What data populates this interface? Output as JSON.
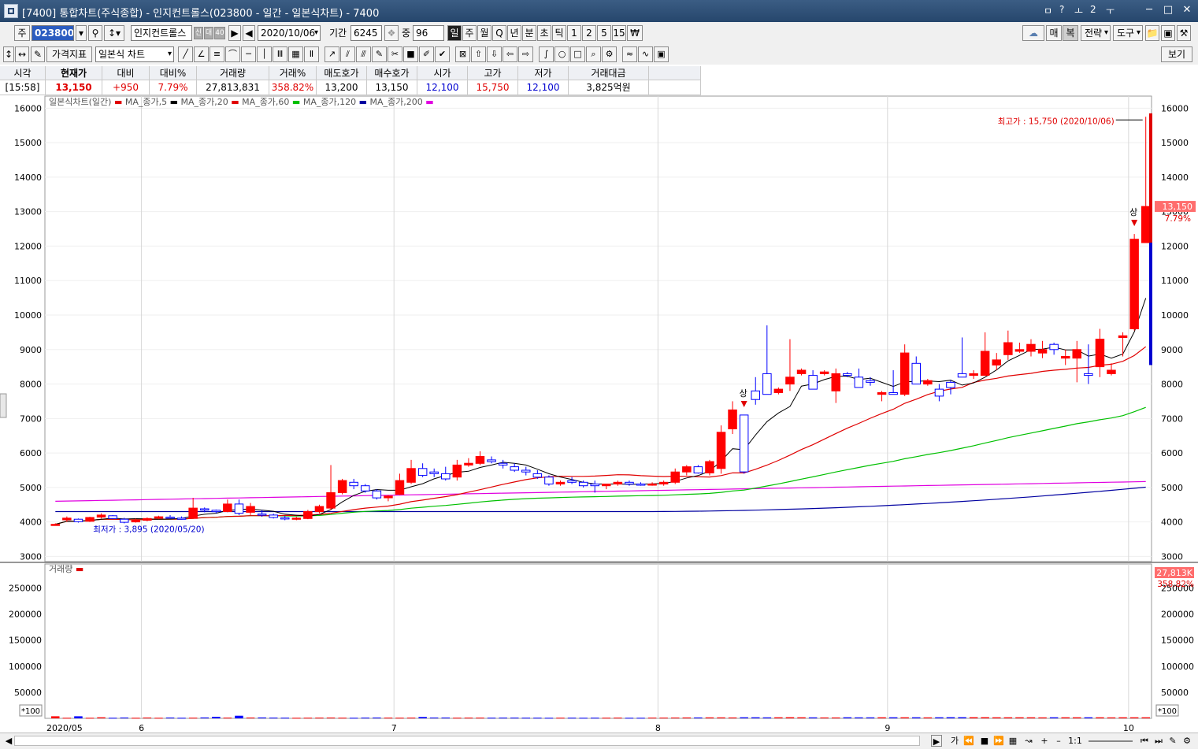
{
  "window": {
    "title": "[7400] 통합차트(주식종합) - 인지컨트롤스(023800 - 일간 - 일본식차트) - 7400",
    "title_icons": [
      "ㅁ",
      "?",
      "ㅗ",
      "2",
      "ㅜ"
    ]
  },
  "toolbar1": {
    "market_label": "주",
    "stock_code": "023800",
    "stock_name": "인지컨트롤스",
    "small_tags": [
      "신",
      "대",
      "40"
    ],
    "date": "2020/10/06",
    "period_label": "기간",
    "period_value": "6245",
    "count_label": "중",
    "count_value": "96",
    "periods": [
      "일",
      "주",
      "월",
      "Q",
      "년",
      "분",
      "초",
      "틱",
      "1",
      "2",
      "5",
      "15",
      "₩"
    ],
    "right_buttons": [
      "매",
      "복",
      "전략",
      "도구"
    ]
  },
  "toolbar2": {
    "indicator_label": "가격지표",
    "chart_type": "일본식 차트",
    "view_button": "보기"
  },
  "quote": {
    "headers": [
      "시각",
      "현재가",
      "대비",
      "대비%",
      "거래량",
      "거래%",
      "매도호가",
      "매수호가",
      "시가",
      "고가",
      "저가",
      "거래대금"
    ],
    "values": [
      "[15:58]",
      "13,150",
      "+950",
      "7.79%",
      "27,813,831",
      "358.82%",
      "13,200",
      "13,150",
      "12,100",
      "15,750",
      "12,100",
      "3,825억원"
    ]
  },
  "legend": {
    "price": "일본식차트(일간)",
    "ma5": "MA_종가,5",
    "ma20": "MA_종가,20",
    "ma60": "MA_종가,60",
    "ma120": "MA_종가,120",
    "ma200": "MA_종가,200",
    "volume": "거래량"
  },
  "colors": {
    "up": "#ff0000",
    "down": "#0000ff",
    "ma5": "#000000",
    "ma20": "#e00000",
    "ma60": "#00c000",
    "ma120": "#0000a0",
    "ma200": "#e000e0"
  },
  "bottom": {
    "first_label": "가",
    "scale_label": "1:1"
  },
  "chart_data": {
    "type": "candlestick",
    "x_tick_labels": [
      "2020/05",
      "6",
      "7",
      "8",
      "9",
      "10"
    ],
    "x_tick_index": [
      0,
      8,
      30,
      53,
      73,
      94
    ],
    "y_ticks": [
      3000,
      4000,
      5000,
      6000,
      7000,
      8000,
      9000,
      10000,
      11000,
      12000,
      13000,
      14000,
      15000,
      16000
    ],
    "ylim": [
      2850,
      16350
    ],
    "volume_ticks": [
      50000,
      100000,
      150000,
      200000,
      250000
    ],
    "volume_ylim": [
      0,
      290000
    ],
    "volume_unit": "*100",
    "current_price_label": "13,150",
    "current_change_label": "7.79%",
    "volume_current_label": "27,813K",
    "volume_change_label": "358.82%",
    "high_annotation": "최고가 : 15,750 (2020/10/06)",
    "low_annotation": "최저가 : 3,895 (2020/05/20)",
    "limit_up_marker": "상",
    "limit_up_index": [
      60,
      94
    ],
    "ohlc": [
      [
        3895,
        3960,
        3895,
        3930
      ],
      [
        4060,
        4160,
        4000,
        4110
      ],
      [
        4080,
        4100,
        3980,
        4010
      ],
      [
        4020,
        4150,
        4000,
        4130
      ],
      [
        4140,
        4250,
        4100,
        4200
      ],
      [
        4180,
        4200,
        4080,
        4100
      ],
      [
        4080,
        4120,
        3960,
        3990
      ],
      [
        4000,
        4100,
        3980,
        4060
      ],
      [
        4050,
        4130,
        4020,
        4100
      ],
      [
        4110,
        4180,
        4080,
        4150
      ],
      [
        4140,
        4200,
        4100,
        4120
      ],
      [
        4110,
        4160,
        4070,
        4090
      ],
      [
        4100,
        4700,
        4090,
        4400
      ],
      [
        4380,
        4420,
        4280,
        4350
      ],
      [
        4340,
        4360,
        4250,
        4300
      ],
      [
        4300,
        4650,
        4280,
        4520
      ],
      [
        4520,
        4650,
        4200,
        4250
      ],
      [
        4280,
        4550,
        4200,
        4450
      ],
      [
        4230,
        4350,
        4150,
        4200
      ],
      [
        4200,
        4240,
        4100,
        4130
      ],
      [
        4120,
        4180,
        4050,
        4090
      ],
      [
        4090,
        4150,
        4050,
        4110
      ],
      [
        4100,
        4350,
        4080,
        4300
      ],
      [
        4300,
        4500,
        4250,
        4450
      ],
      [
        4400,
        5650,
        4350,
        4850
      ],
      [
        4850,
        5250,
        4800,
        5200
      ],
      [
        5150,
        5250,
        4950,
        5050
      ],
      [
        5050,
        5100,
        4850,
        4900
      ],
      [
        4900,
        4950,
        4650,
        4700
      ],
      [
        4700,
        4780,
        4600,
        4750
      ],
      [
        4800,
        5400,
        4780,
        5200
      ],
      [
        5150,
        5800,
        5100,
        5550
      ],
      [
        5550,
        5700,
        5300,
        5350
      ],
      [
        5450,
        5550,
        5300,
        5400
      ],
      [
        5400,
        5600,
        5200,
        5250
      ],
      [
        5300,
        5800,
        5200,
        5650
      ],
      [
        5650,
        5850,
        5600,
        5700
      ],
      [
        5700,
        6050,
        5650,
        5900
      ],
      [
        5800,
        5900,
        5700,
        5750
      ],
      [
        5700,
        5800,
        5550,
        5650
      ],
      [
        5600,
        5700,
        5450,
        5500
      ],
      [
        5500,
        5600,
        5350,
        5450
      ],
      [
        5400,
        5500,
        5250,
        5300
      ],
      [
        5300,
        5350,
        5050,
        5100
      ],
      [
        5100,
        5200,
        5050,
        5150
      ],
      [
        5200,
        5300,
        5100,
        5150
      ],
      [
        5150,
        5200,
        5000,
        5050
      ],
      [
        5100,
        5200,
        4850,
        5050
      ],
      [
        5050,
        5100,
        4950,
        5100
      ],
      [
        5100,
        5200,
        5050,
        5150
      ],
      [
        5150,
        5200,
        5050,
        5100
      ],
      [
        5100,
        5150,
        5050,
        5080
      ],
      [
        5080,
        5150,
        5050,
        5100
      ],
      [
        5100,
        5200,
        5050,
        5150
      ],
      [
        5150,
        5550,
        5100,
        5450
      ],
      [
        5450,
        5650,
        5350,
        5600
      ],
      [
        5600,
        5650,
        5400,
        5420
      ],
      [
        5420,
        5800,
        5350,
        5750
      ],
      [
        5550,
        6800,
        5400,
        6600
      ],
      [
        6700,
        7500,
        6550,
        7250
      ],
      [
        7100,
        7100,
        5400,
        5450
      ],
      [
        7800,
        8200,
        7400,
        7550
      ],
      [
        8300,
        9700,
        7700,
        7700
      ],
      [
        7750,
        7900,
        7700,
        7850
      ],
      [
        8000,
        9300,
        7800,
        8200
      ],
      [
        8300,
        8450,
        8250,
        8400
      ],
      [
        8250,
        8400,
        7900,
        7850
      ],
      [
        8300,
        8400,
        8250,
        8350
      ],
      [
        7800,
        8450,
        7450,
        8300
      ],
      [
        8300,
        8350,
        8200,
        8250
      ],
      [
        8200,
        8450,
        7900,
        7900
      ],
      [
        8100,
        8200,
        7950,
        8050
      ],
      [
        7700,
        7800,
        7500,
        7750
      ],
      [
        7750,
        8400,
        7700,
        7700
      ],
      [
        7700,
        9150,
        7650,
        8900
      ],
      [
        8600,
        8800,
        8000,
        8000
      ],
      [
        8000,
        8150,
        7950,
        8100
      ],
      [
        7850,
        8000,
        7500,
        7650
      ],
      [
        8050,
        8100,
        7700,
        7900
      ],
      [
        8300,
        9350,
        8200,
        8200
      ],
      [
        8250,
        8400,
        8150,
        8300
      ],
      [
        8250,
        9500,
        8250,
        8950
      ],
      [
        8550,
        8900,
        8400,
        8700
      ],
      [
        8850,
        9550,
        8700,
        9200
      ],
      [
        8950,
        9200,
        8900,
        9000
      ],
      [
        8950,
        9300,
        8800,
        9150
      ],
      [
        8900,
        9250,
        8750,
        9000
      ],
      [
        9150,
        9200,
        8850,
        9000
      ],
      [
        8750,
        9000,
        8550,
        8800
      ],
      [
        8750,
        9250,
        8050,
        9000
      ],
      [
        8300,
        9150,
        8000,
        8250
      ],
      [
        8500,
        9600,
        8200,
        9300
      ],
      [
        8300,
        8600,
        8250,
        8400
      ],
      [
        9350,
        9500,
        8800,
        9400
      ],
      [
        9600,
        12350,
        9550,
        12200
      ],
      [
        12100,
        15750,
        12100,
        13150
      ]
    ],
    "volume": [
      4000,
      1000,
      4000,
      1000,
      2000,
      1000,
      1500,
      1000,
      1500,
      1000,
      1500,
      1000,
      1200,
      1600,
      3000,
      1400,
      5000,
      1500,
      1600,
      1400,
      1200,
      1000,
      1200,
      1300,
      1500,
      1200,
      1000,
      1300,
      1500,
      1400,
      1200,
      1400,
      2500,
      1500,
      1500,
      1200,
      1300,
      1400,
      1200,
      1400,
      1300,
      1200,
      1200,
      1100,
      1200,
      1200,
      1000,
      1200,
      1200,
      1300,
      1100,
      1100,
      1300,
      1400,
      1500,
      1600,
      1700,
      1800,
      1800,
      1600,
      1900,
      2000,
      1800,
      1900,
      2100,
      1900,
      1800,
      1700,
      1700,
      1900,
      1800,
      1800,
      1900,
      1900,
      2000,
      1900,
      1800,
      2000,
      2100,
      2100,
      2100,
      2100,
      2000,
      2000,
      1900,
      2000,
      1800,
      2000,
      2000,
      2000,
      1900,
      2000,
      1800,
      2000,
      2000,
      2000
    ]
  }
}
